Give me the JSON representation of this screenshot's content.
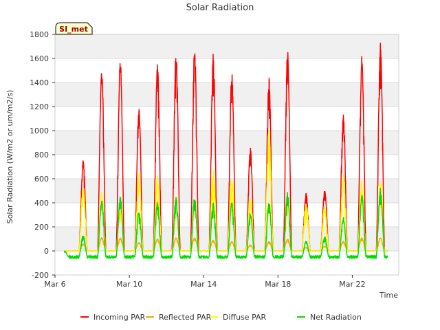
{
  "chart_data": {
    "type": "line",
    "title": "Solar Radiation",
    "xlabel": "Time",
    "ylabel": "Solar Radiation (W/m2 or um/m2/s)",
    "station_label": "SI_met",
    "xlim": [
      6,
      24.5
    ],
    "ylim": [
      -200,
      1800
    ],
    "yticks": [
      -200,
      0,
      200,
      400,
      600,
      800,
      1000,
      1200,
      1400,
      1600,
      1800
    ],
    "xticks": [
      {
        "value": 6,
        "label": "Mar 6"
      },
      {
        "value": 10,
        "label": "Mar 10"
      },
      {
        "value": 14,
        "label": "Mar 14"
      },
      {
        "value": 18,
        "label": "Mar 18"
      },
      {
        "value": 22,
        "label": "Mar 22"
      }
    ],
    "grid": "horizontal bands",
    "legend_position": "bottom",
    "x_start": 6.5,
    "x_end": 23.9,
    "daily_peaks": {
      "days": [
        6,
        7,
        8,
        9,
        10,
        11,
        12,
        13,
        14,
        15,
        16,
        17,
        18,
        19,
        20,
        21,
        22,
        23
      ],
      "incoming_par": [
        0,
        750,
        1540,
        1600,
        1180,
        1550,
        1665,
        1700,
        1640,
        1490,
        860,
        1440,
        1670,
        480,
        510,
        1140,
        1630,
        1730
      ],
      "reflected_par": [
        0,
        60,
        110,
        110,
        70,
        100,
        110,
        110,
        90,
        80,
        50,
        80,
        100,
        30,
        40,
        80,
        110,
        110
      ],
      "diffuse_par": [
        0,
        550,
        500,
        420,
        650,
        640,
        460,
        420,
        680,
        620,
        450,
        1000,
        440,
        400,
        380,
        650,
        600,
        600
      ],
      "net_radiation": [
        0,
        130,
        430,
        460,
        340,
        420,
        460,
        450,
        400,
        410,
        320,
        420,
        490,
        80,
        120,
        280,
        470,
        530
      ]
    },
    "night_net_radiation": -50,
    "series": [
      {
        "name": "Incoming PAR",
        "color": "#ff0000",
        "key": "incoming_par"
      },
      {
        "name": "Reflected PAR",
        "color": "#ffa500",
        "key": "reflected_par"
      },
      {
        "name": "Diffuse PAR",
        "color": "#ffff00",
        "key": "diffuse_par"
      },
      {
        "name": "Net Radiation",
        "color": "#00dd00",
        "key": "net_radiation"
      }
    ]
  }
}
